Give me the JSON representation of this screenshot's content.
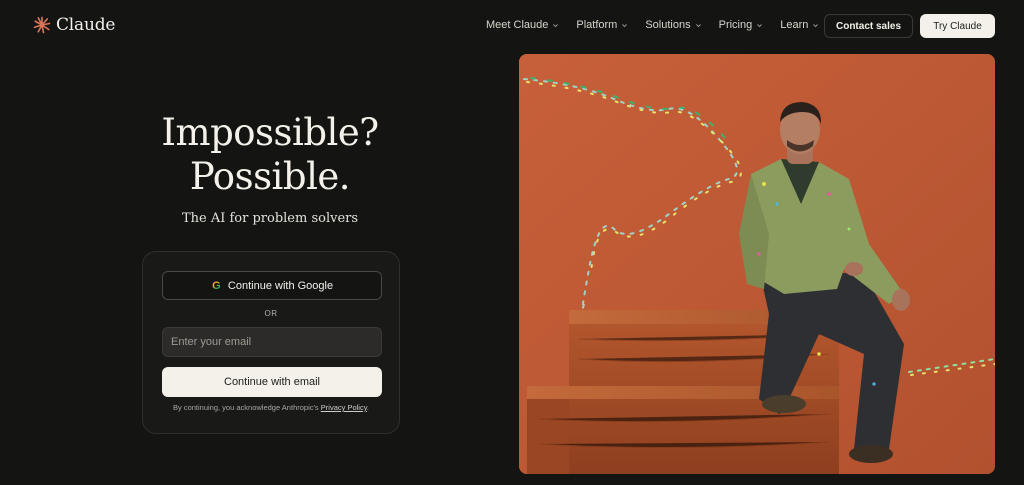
{
  "brand": {
    "name": "Claude"
  },
  "nav": {
    "menu": [
      {
        "label": "Meet Claude"
      },
      {
        "label": "Platform"
      },
      {
        "label": "Solutions"
      },
      {
        "label": "Pricing"
      },
      {
        "label": "Learn"
      }
    ],
    "contact_label": "Contact sales",
    "try_label": "Try Claude"
  },
  "hero": {
    "headline_line1": "Impossible?",
    "headline_line2": "Possible.",
    "subhead": "The AI for problem solvers"
  },
  "auth": {
    "google_label": "Continue with Google",
    "or_label": "OR",
    "email_placeholder": "Enter your email",
    "email_button_label": "Continue with email",
    "legal_prefix": "By continuing, you acknowledge Anthropic's",
    "privacy_link": "Privacy Policy",
    "legal_suffix": "."
  },
  "colors": {
    "background": "#141413",
    "photo_background": "#bf5a36",
    "accent_logo": "#d97757",
    "primary_button": "#f3f1ea"
  },
  "icons": {
    "logo": "claude-burst-icon",
    "menu_chevron": "chevron-down-icon",
    "google": "google-g-icon"
  }
}
